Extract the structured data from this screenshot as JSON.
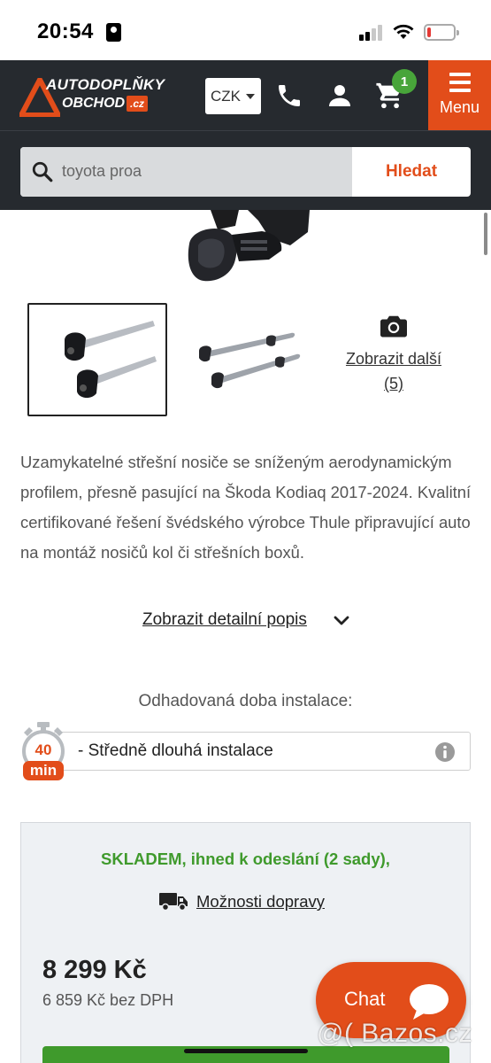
{
  "status_bar": {
    "time": "20:54",
    "battery_level": 0.15
  },
  "header": {
    "logo": {
      "line1": "AUTODOPLŇKY",
      "line2": "OBCHOD",
      "domain": ".cz"
    },
    "currency": "CZK",
    "cart_count": "1",
    "menu_label": "Menu",
    "icons": [
      "phone-icon",
      "user-icon",
      "cart-icon",
      "hamburger-icon"
    ]
  },
  "search": {
    "placeholder": "toyota proa",
    "button_label": "Hledat"
  },
  "gallery": {
    "more_label": "Zobrazit další",
    "more_count": "(5)"
  },
  "description": {
    "text": "Uzamykatelné střešní nosiče se sníženým aerodynamickým profilem, přesně pasující na Škoda Kodiaq 2017-2024. Kvalitní certifikované řešení švédského výrobce Thule připravující auto na montáž nosičů kol či střešních boxů.",
    "detail_link": "Zobrazit detailní popis"
  },
  "installation": {
    "label": "Odhadovaná doba instalace:",
    "value": "- Středně dlouhá instalace",
    "timer_number": "40",
    "timer_unit": "min"
  },
  "stock": {
    "status": "SKLADEM, ihned k odeslání (2 sady),",
    "shipping_link": "Možnosti dopravy",
    "price": "8 299 Kč",
    "price_net": "6 859 Kč bez DPH"
  },
  "chat": {
    "label": "Chat"
  },
  "watermark": "@( Bazos.cz",
  "colors": {
    "brand_orange": "#e24d1a",
    "header_dark": "#262a2f",
    "stock_green": "#3f9a2c"
  }
}
